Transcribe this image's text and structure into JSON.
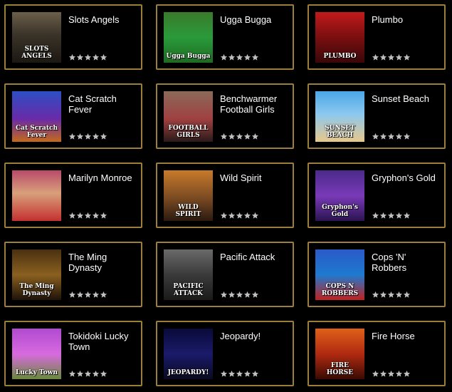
{
  "star_color": "#bfbfbf",
  "border_color": "#9c7f3a",
  "games": [
    {
      "title": "Slots Angels",
      "thumb_text": "SLOTS ANGELS",
      "thumb_bg": "linear-gradient(180deg,#6b5f4a 0%,#3a3328 45%,#1c1812 100%)",
      "rating": 5
    },
    {
      "title": "Ugga Bugga",
      "thumb_text": "Ugga Bugga",
      "thumb_bg": "linear-gradient(180deg,#3a7a2a 0%,#2a9a3a 50%,#1e6b22 100%)",
      "rating": 5
    },
    {
      "title": "Plumbo",
      "thumb_text": "PLUMBO",
      "thumb_bg": "linear-gradient(180deg,#c21a1a 0%,#7a0f10 50%,#3a0708 100%)",
      "rating": 5
    },
    {
      "title": "Cat Scratch Fever",
      "thumb_text": "Cat Scratch Fever",
      "thumb_bg": "linear-gradient(180deg,#2d4fc4 0%,#6a2aa8 55%,#c46a1a 100%)",
      "rating": 5
    },
    {
      "title": "Benchwarmer Football Girls",
      "thumb_text": "FOOTBALL GIRLS",
      "thumb_bg": "linear-gradient(180deg,#8a6a5a 0%,#a04040 55%,#2a1a1a 100%)",
      "rating": 5
    },
    {
      "title": "Sunset Beach",
      "thumb_text": "SUNSET BEACH",
      "thumb_bg": "linear-gradient(180deg,#4aa6e6 0%,#8cc8f0 45%,#e8c88a 100%)",
      "rating": 5
    },
    {
      "title": "Marilyn Monroe",
      "thumb_text": "",
      "thumb_bg": "linear-gradient(180deg,#b84a6a 0%,#d8a07a 45%,#c43030 100%)",
      "rating": 5
    },
    {
      "title": "Wild Spirit",
      "thumb_text": "WILD SPIRIT",
      "thumb_bg": "linear-gradient(180deg,#c87a2a 0%,#7a4a22 55%,#2a1a10 100%)",
      "rating": 5
    },
    {
      "title": "Gryphon's Gold",
      "thumb_text": "Gryphon's Gold",
      "thumb_bg": "linear-gradient(180deg,#4a2a8a 0%,#7a3ab8 50%,#2a1450 100%)",
      "rating": 5
    },
    {
      "title": "The Ming Dynasty",
      "thumb_text": "The Ming Dynasty",
      "thumb_bg": "linear-gradient(180deg,#4a3010 0%,#8a6020 50%,#1e1208 100%)",
      "rating": 5
    },
    {
      "title": "Pacific Attack",
      "thumb_text": "PACIFIC ATTACK",
      "thumb_bg": "linear-gradient(180deg,#6a6a6a 0%,#3a3a3a 50%,#1a1a1a 100%)",
      "rating": 5
    },
    {
      "title": "Cops 'N' Robbers",
      "thumb_text": "COPS N ROBBERS",
      "thumb_bg": "linear-gradient(180deg,#2a5ac8 0%,#1e7ad0 50%,#c02020 100%)",
      "rating": 5
    },
    {
      "title": "Tokidoki Lucky Town",
      "thumb_text": "Lucky Town",
      "thumb_bg": "linear-gradient(180deg,#b04ad0 0%,#d86ae0 50%,#6a8a3a 100%)",
      "rating": 5
    },
    {
      "title": "Jeopardy!",
      "thumb_text": "JEOPARDY!",
      "thumb_bg": "linear-gradient(180deg,#0a0a3a 0%,#1a1a6a 50%,#0a0a20 100%)",
      "rating": 5
    },
    {
      "title": "Fire Horse",
      "thumb_text": "FIRE HORSE",
      "thumb_bg": "linear-gradient(180deg,#e0601a 0%,#b02a10 50%,#3a0a04 100%)",
      "rating": 5
    }
  ]
}
